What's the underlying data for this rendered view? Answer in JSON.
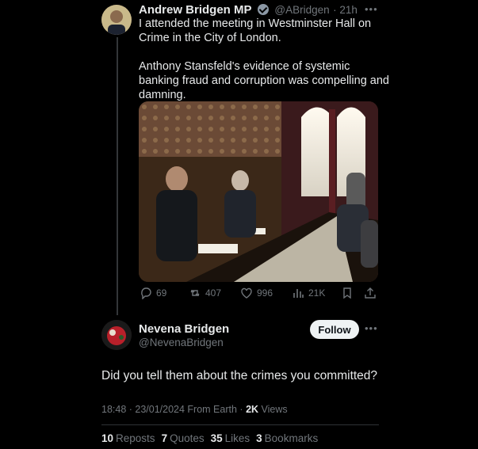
{
  "tweet": {
    "author_name": "Andrew Bridgen MP",
    "handle": "@ABridgen",
    "time": "· 21h",
    "line1": "I attended the meeting in Westminster Hall on",
    "line2": "Crime in the City of London.",
    "line3": "Anthony Stansfeld's evidence of systemic",
    "line4": "banking fraud and corruption was compelling and",
    "line5": "damning.",
    "actions": {
      "replies": "69",
      "reposts": "407",
      "likes": "996",
      "views": "21K"
    }
  },
  "reply": {
    "author_name": "Nevena Bridgen",
    "handle": "@NevenaBridgen",
    "follow_label": "Follow",
    "text": "Did you tell them about the crimes you committed?",
    "timestamp": "18:48 · 23/01/2024 From Earth ·",
    "views_count": "2K",
    "views_label": "Views",
    "stats": [
      {
        "count": "10",
        "label": "Reposts"
      },
      {
        "count": "7",
        "label": "Quotes"
      },
      {
        "count": "35",
        "label": "Likes"
      },
      {
        "count": "3",
        "label": "Bookmarks"
      }
    ]
  },
  "icons": {
    "reply": "speech-bubble",
    "repost": "two-arrows-loop",
    "like": "heart",
    "views": "bar-chart",
    "bookmark": "bookmark",
    "share": "upload-arrow",
    "more": "ellipsis"
  },
  "colors": {
    "background": "#000000",
    "text": "#e7e9ea",
    "muted": "#71767b",
    "follow_button": "#eff3f4"
  }
}
